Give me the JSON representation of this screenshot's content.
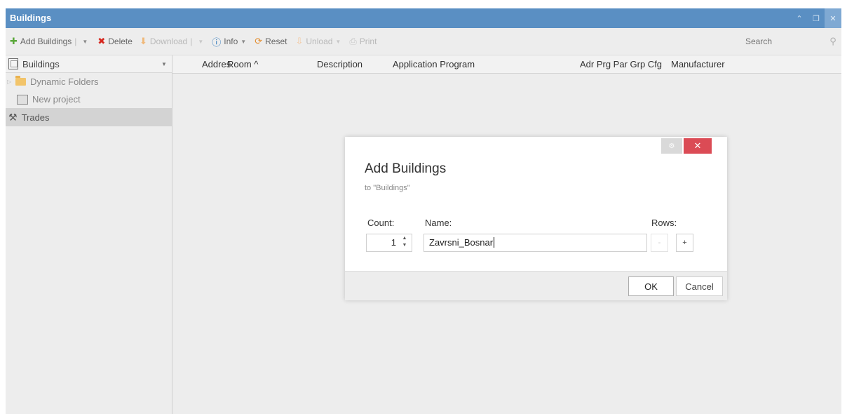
{
  "window": {
    "title": "Buildings"
  },
  "toolbar": {
    "add_buildings": "Add Buildings",
    "delete": "Delete",
    "download": "Download",
    "info": "Info",
    "reset": "Reset",
    "unload": "Unload",
    "print": "Print",
    "search_placeholder": "Search"
  },
  "left_panel": {
    "header": "Buildings",
    "items": [
      {
        "label": "Dynamic Folders",
        "icon": "folder-icon"
      },
      {
        "label": "New project",
        "icon": "project-icon"
      }
    ],
    "trades": "Trades"
  },
  "grid": {
    "columns": [
      "Addres",
      "Room ^",
      "Description",
      "Application Program",
      "Adr Prg Par Grp Cfg",
      "Manufacturer"
    ]
  },
  "dialog": {
    "title": "Add Buildings",
    "subtitle": "to \"Buildings\"",
    "count_label": "Count:",
    "count_value": "1",
    "name_label": "Name:",
    "name_value": "Zavrsni_Bosnar",
    "rows_label": "Rows:",
    "rows_minus": "-",
    "rows_plus": "+",
    "ok": "OK",
    "cancel": "Cancel"
  },
  "colors": {
    "title_bar": "#5a8fc3",
    "close_button": "#db4b55"
  }
}
